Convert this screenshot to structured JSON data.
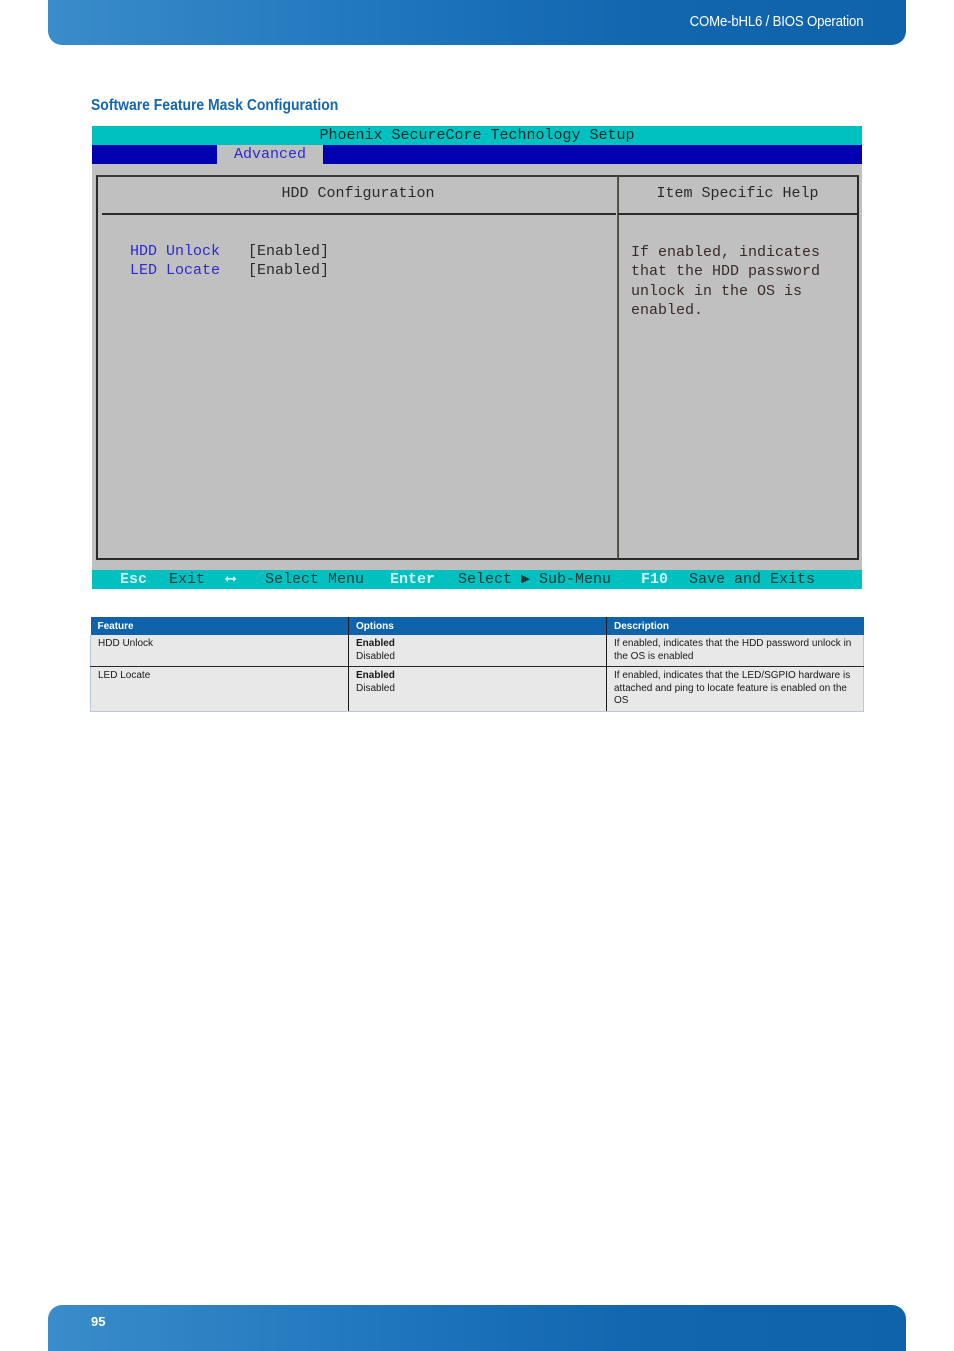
{
  "header": {
    "doc_title": "COMe-bHL6 / BIOS Operation"
  },
  "footer": {
    "page_number": "95"
  },
  "section_title": "Software Feature Mask Configuration",
  "bios": {
    "title": "Phoenix SecureCore Technology Setup",
    "active_tab": "Advanced",
    "left_panel": {
      "heading": "HDD Configuration",
      "items": [
        {
          "label": "HDD Unlock",
          "value": "[Enabled]"
        },
        {
          "label": "LED Locate",
          "value": "[Enabled]"
        }
      ]
    },
    "right_panel": {
      "heading": "Item Specific Help",
      "help_text": "If enabled, indicates\nthat the HDD password\nunlock in the OS is\nenabled."
    },
    "status_bar": [
      {
        "key": "Esc",
        "action": "Exit"
      },
      {
        "key": "⟷",
        "action": "Select Menu"
      },
      {
        "key": "Enter",
        "action": "Select ▶ Sub-Menu"
      },
      {
        "key": "F10",
        "action": "Save and Exits"
      }
    ]
  },
  "table": {
    "headers": [
      "Feature",
      "Options",
      "Description"
    ],
    "rows": [
      {
        "feature": "HDD Unlock",
        "default_option": "Enabled",
        "other_option": "Disabled",
        "description": "If enabled, indicates that the HDD password unlock in the OS is enabled"
      },
      {
        "feature": "LED Locate",
        "default_option": "Enabled",
        "other_option": "Disabled",
        "description": "If enabled, indicates that the LED/SGPIO hardware is attached and ping to locate feature is enabled on the OS"
      }
    ]
  }
}
